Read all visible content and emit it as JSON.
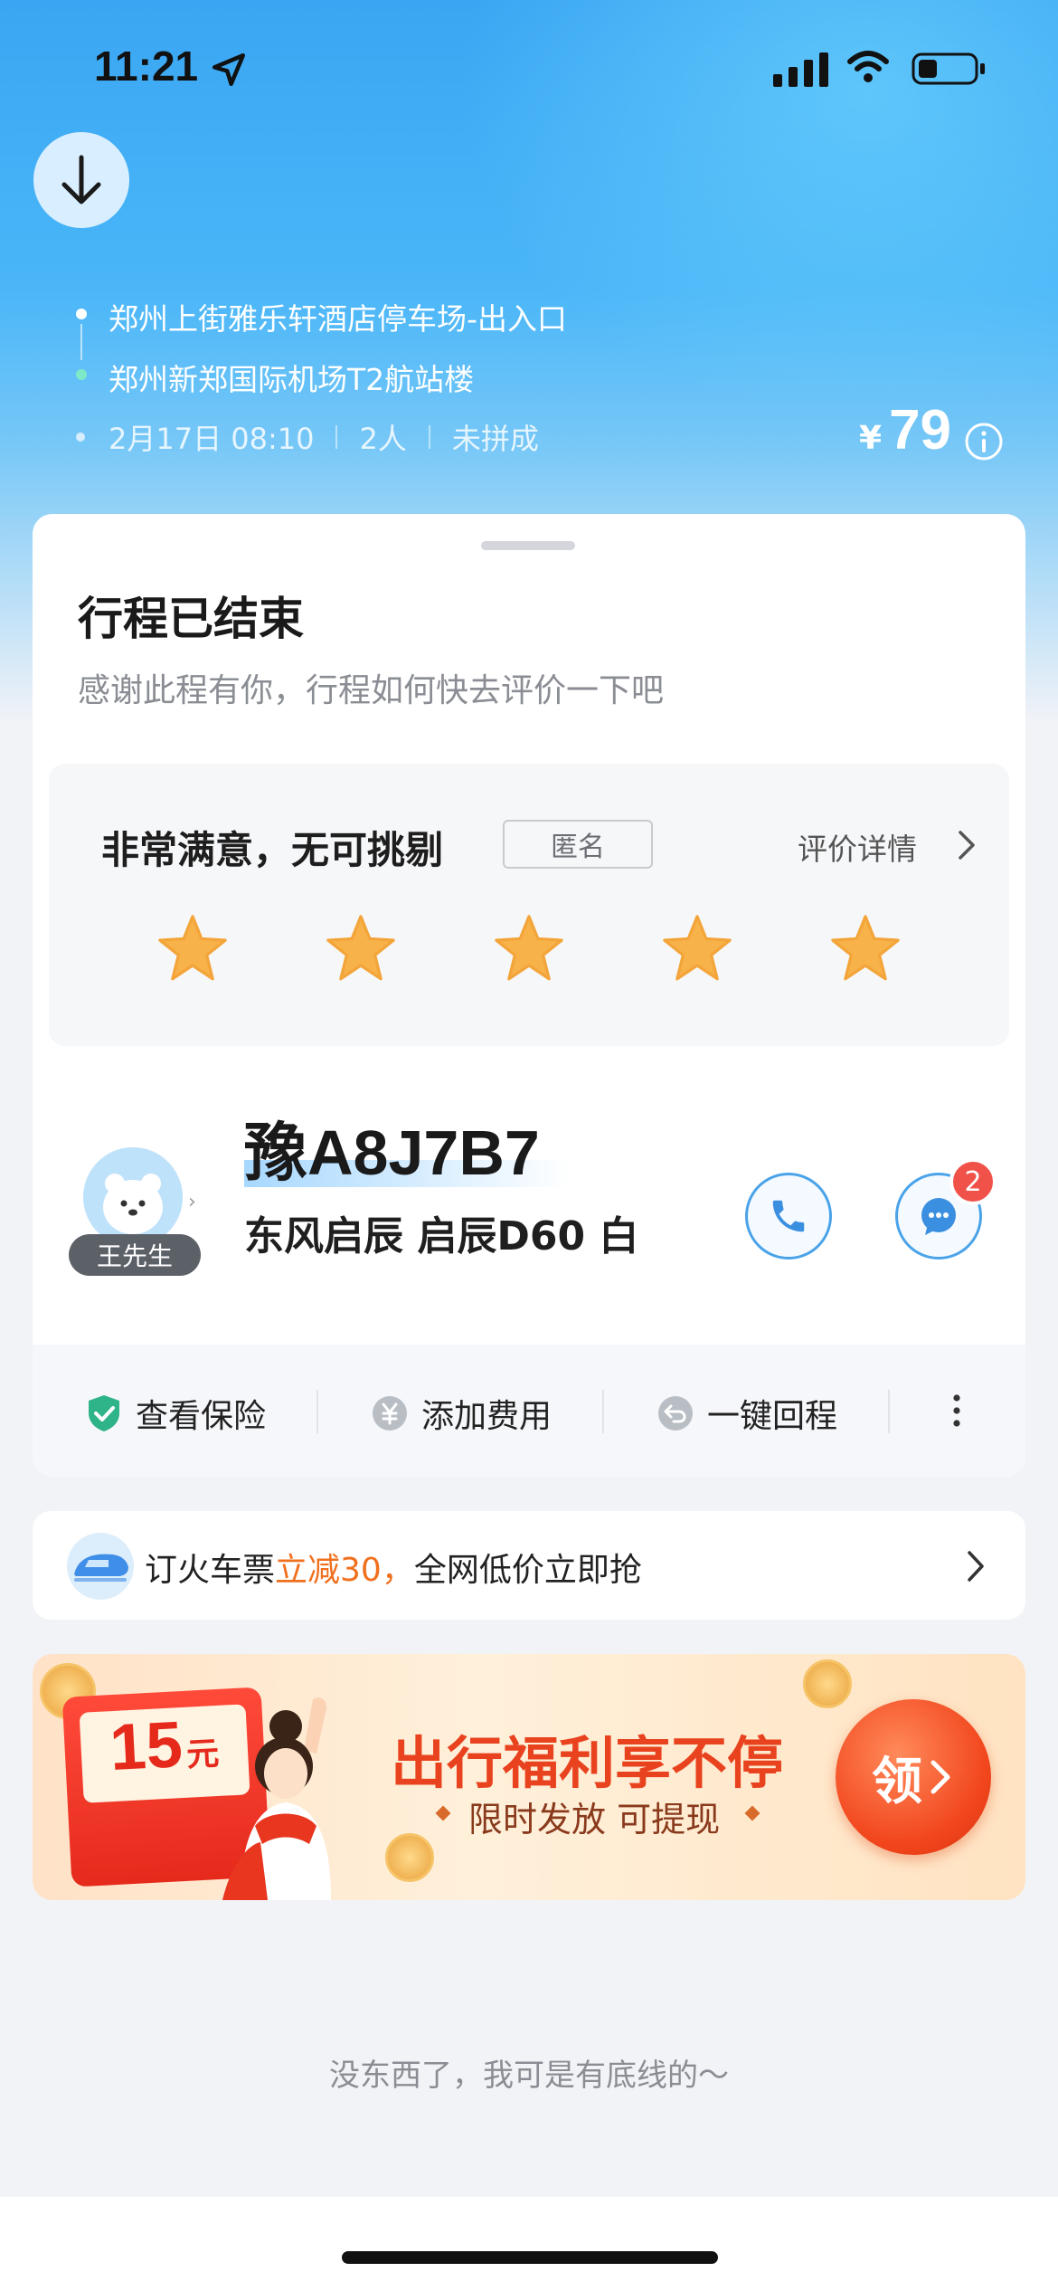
{
  "status_bar": {
    "time": "11:21"
  },
  "trip": {
    "from": "郑州上街雅乐轩酒店停车场-出入口",
    "to": "郑州新郑国际机场T2航站楼",
    "date": "2月17日 08:10",
    "passengers": "2人",
    "carpool_status": "未拼成",
    "currency": "¥",
    "price": "79"
  },
  "card": {
    "title": "行程已结束",
    "subtitle": "感谢此程有你，行程如何快去评价一下吧"
  },
  "rating": {
    "text": "非常满意，无可挑剔",
    "anonymous_label": "匿名",
    "detail_link": "评价详情",
    "stars": 5
  },
  "driver": {
    "name": "王先生",
    "plate": "豫A8J7B7",
    "car": "东风启辰 启辰D60 白",
    "message_badge": "2"
  },
  "actions": [
    {
      "label": "查看保险"
    },
    {
      "label": "添加费用"
    },
    {
      "label": "一键回程"
    }
  ],
  "promo": {
    "prefix": "订火车票",
    "highlight": "立减30，",
    "suffix": "全网低价立即抢"
  },
  "banner": {
    "coupon_amount": "15",
    "coupon_unit": "元",
    "title": "出行福利享不停",
    "subtitle": "限时发放 可提现",
    "button": "领"
  },
  "footer": "没东西了，我可是有底线的～",
  "colors": {
    "accent": "#3aa6f3",
    "star": "#f7b24a",
    "promo_highlight": "#f0701e",
    "banner_red": "#e8431e"
  }
}
